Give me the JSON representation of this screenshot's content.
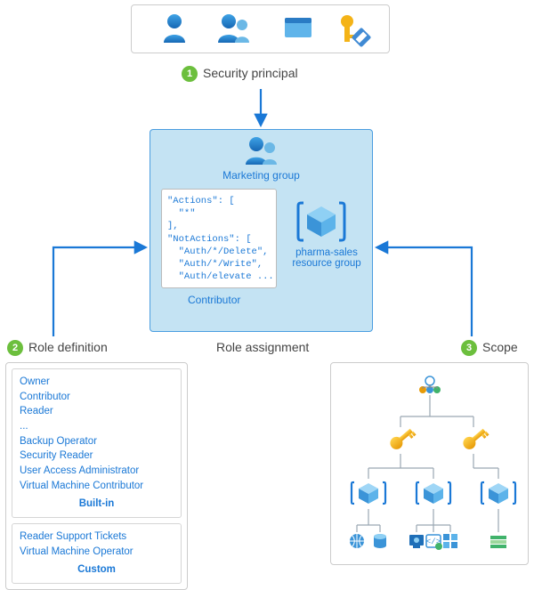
{
  "section1": {
    "num": "1",
    "label": "Security principal"
  },
  "section2": {
    "num": "2",
    "label": "Role definition"
  },
  "section3": {
    "num": "3",
    "label": "Scope"
  },
  "center": {
    "title": "Role assignment",
    "group_label": "Marketing group",
    "code": "\"Actions\": [\n  \"*\"\n],\n\"NotActions\": [\n  \"Auth/*/Delete\",\n  \"Auth/*/Write\",\n  \"Auth/elevate ...",
    "code_caption": "Contributor",
    "resource_group_label": "pharma-sales\nresource group"
  },
  "roles": {
    "builtin_label": "Built-in",
    "custom_label": "Custom",
    "builtin_ellipsis": "...",
    "builtin1": "Owner",
    "builtin2": "Contributor",
    "builtin3": "Reader",
    "builtin4": "Backup Operator",
    "builtin5": "Security Reader",
    "builtin6": "User Access Administrator",
    "builtin7": "Virtual Machine Contributor",
    "custom1": "Reader Support Tickets",
    "custom2": "Virtual Machine Operator"
  }
}
